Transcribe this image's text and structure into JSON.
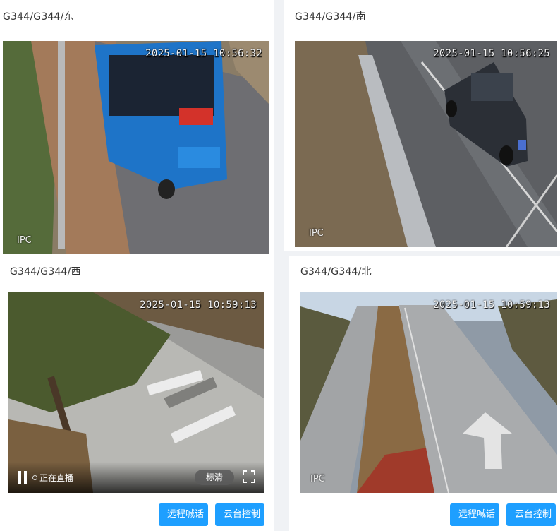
{
  "cameras": [
    {
      "title": "G344/G344/东",
      "timestamp": "2025-01-15 10:56:32",
      "watermark": "IPC"
    },
    {
      "title": "G344/G344/南",
      "timestamp": "2025-01-15 10:56:25",
      "watermark": "IPC"
    },
    {
      "title": "G344/G344/西",
      "timestamp": "2025-01-15 10:59:13",
      "watermark": "",
      "player": {
        "status": "正在直播",
        "quality": "标清",
        "icons": [
          "pause-icon",
          "live-dot-icon",
          "fullscreen-icon"
        ]
      }
    },
    {
      "title": "G344/G344/北",
      "timestamp": "2025-01-15 10:59:13",
      "watermark": "IPC"
    }
  ],
  "actions": {
    "talk_label": "远程喊话",
    "ptz_label": "云台控制"
  },
  "colors": {
    "accent": "#1e9fff",
    "panel_bg": "#ffffff",
    "page_bg": "#f0f2f5"
  }
}
